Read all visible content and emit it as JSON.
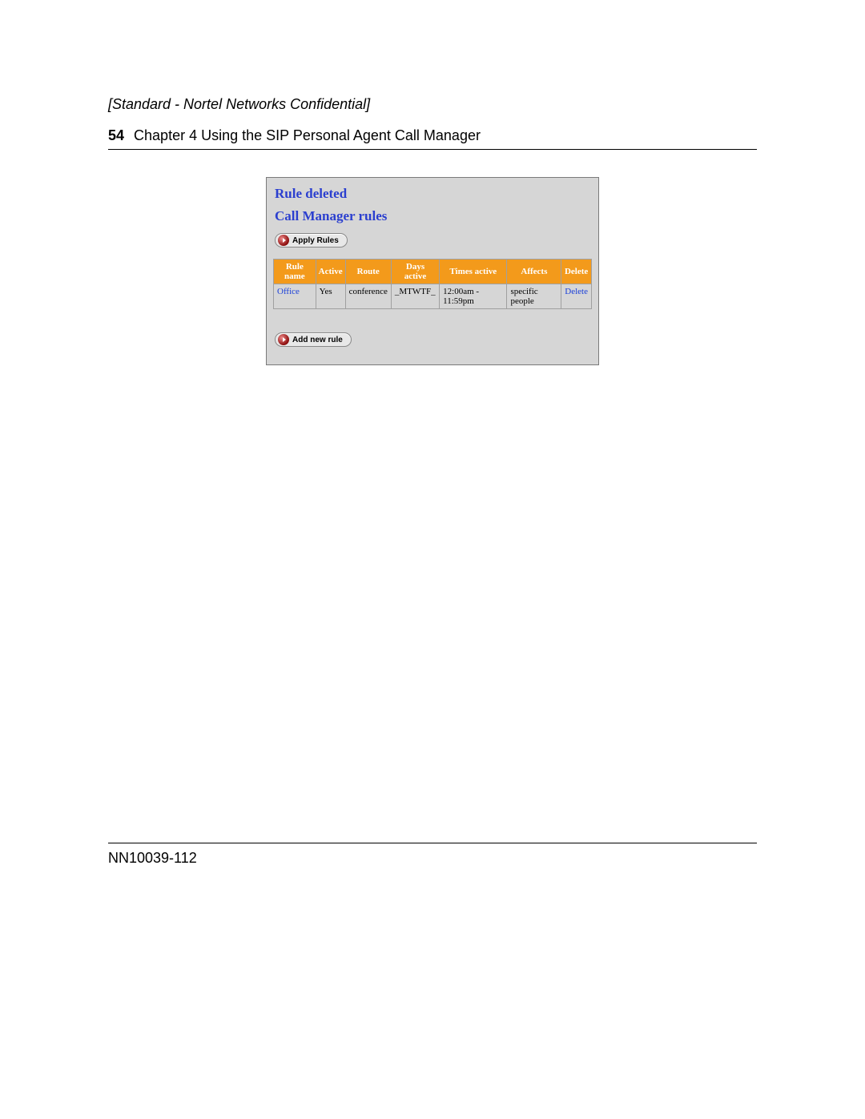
{
  "header": {
    "confidential": "[Standard - Nortel Networks Confidential]",
    "page_number": "54",
    "chapter": "Chapter 4  Using the SIP Personal Agent Call Manager"
  },
  "screenshot": {
    "heading1": "Rule deleted",
    "heading2": "Call Manager rules",
    "apply_button": "Apply Rules",
    "add_button": "Add new rule",
    "table": {
      "headers": [
        "Rule name",
        "Active",
        "Route",
        "Days active",
        "Times active",
        "Affects",
        "Delete"
      ],
      "rows": [
        {
          "rule_name": "Office",
          "active": "Yes",
          "route": "conference",
          "days_active": "_MTWTF_",
          "times_active": "12:00am - 11:59pm",
          "affects": "specific people",
          "delete": "Delete"
        }
      ]
    }
  },
  "footer": {
    "doc_number": "NN10039-112"
  }
}
